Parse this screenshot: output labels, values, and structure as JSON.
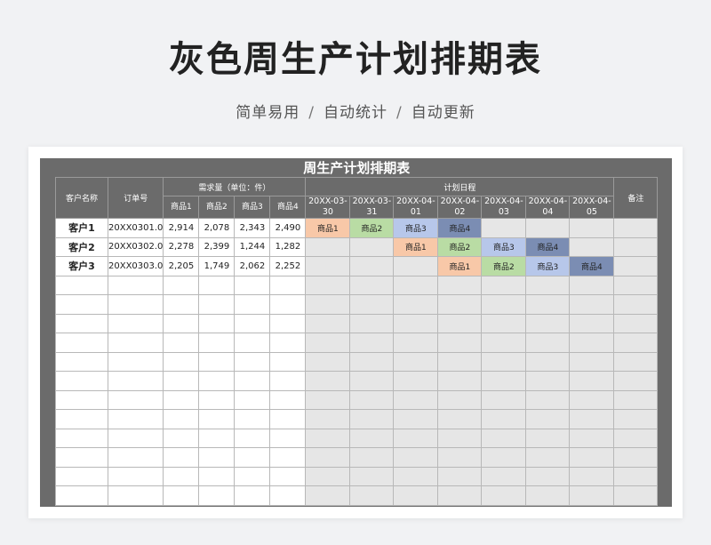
{
  "header": {
    "title": "灰色周生产计划排期表",
    "tags": [
      "简单易用",
      "自动统计",
      "自动更新"
    ],
    "separator": "/"
  },
  "sheet": {
    "title": "周生产计划排期表",
    "columns": {
      "customer": "客户名称",
      "order": "订单号",
      "demand_group": "需求量（单位：件）",
      "products": [
        "商品1",
        "商品2",
        "商品3",
        "商品4"
      ],
      "schedule_group": "计划日程",
      "dates": [
        "20XX-03-30",
        "20XX-03-31",
        "20XX-04-01",
        "20XX-04-02",
        "20XX-04-03",
        "20XX-04-04",
        "20XX-04-05"
      ],
      "remark": "备注"
    },
    "rows": [
      {
        "customer": "客户1",
        "order": "20XX0301.0",
        "qty": [
          "2,914",
          "2,078",
          "2,343",
          "2,490"
        ],
        "schedule": [
          "商品1",
          "商品2",
          "商品3",
          "商品4",
          "",
          "",
          ""
        ]
      },
      {
        "customer": "客户2",
        "order": "20XX0302.0",
        "qty": [
          "2,278",
          "2,399",
          "1,244",
          "1,282"
        ],
        "schedule": [
          "",
          "",
          "商品1",
          "商品2",
          "商品3",
          "商品4",
          ""
        ]
      },
      {
        "customer": "客户3",
        "order": "20XX0303.0",
        "qty": [
          "2,205",
          "1,749",
          "2,062",
          "2,252"
        ],
        "schedule": [
          "",
          "",
          "",
          "商品1",
          "商品2",
          "商品3",
          "商品4"
        ]
      }
    ],
    "empty_rows": 12,
    "product_colors": {
      "商品1": "#f8c8a8",
      "商品2": "#b9dca4",
      "商品3": "#b7c7ea",
      "商品4": "#7b8db3"
    }
  }
}
